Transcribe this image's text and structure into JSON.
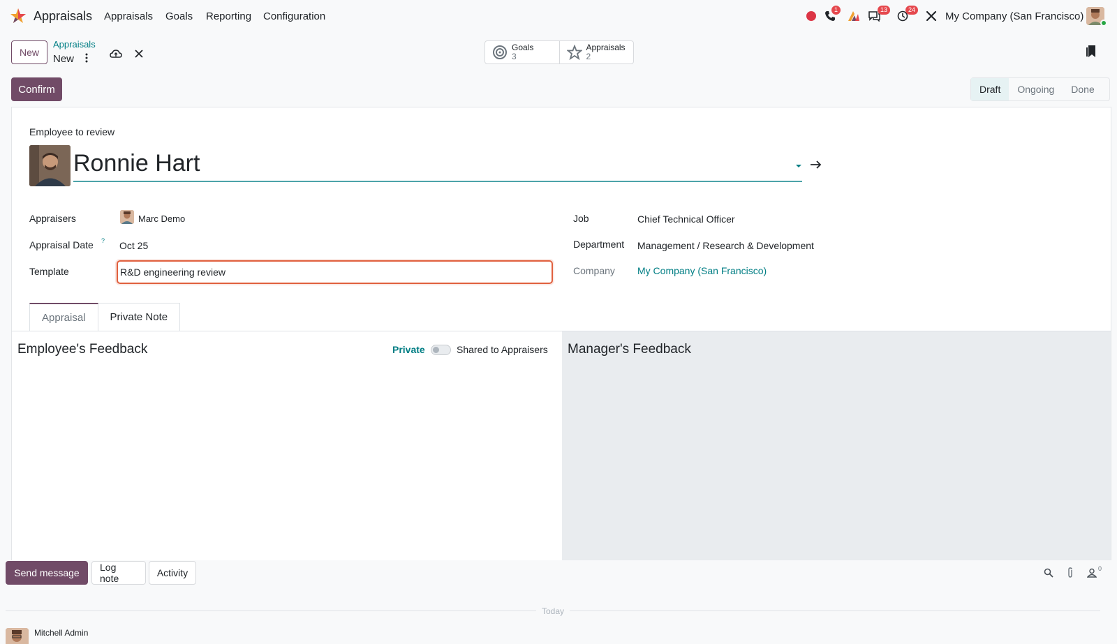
{
  "navbar": {
    "app_name": "Appraisals",
    "menu": [
      "Appraisals",
      "Goals",
      "Reporting",
      "Configuration"
    ],
    "badges": {
      "calls": "1",
      "messages": "13",
      "activities": "24"
    },
    "company": "My Company (San Francisco)",
    "icons": [
      "record-icon",
      "phone-icon",
      "tools-logo-icon",
      "chat-icon",
      "clock-icon",
      "settings-cross-icon"
    ]
  },
  "control_panel": {
    "new_label": "New",
    "breadcrumb_parent": "Appraisals",
    "breadcrumb_current": "New",
    "smart_buttons": [
      {
        "label": "Goals",
        "count": "3",
        "icon": "target-icon"
      },
      {
        "label": "Appraisals",
        "count": "2",
        "icon": "star-icon"
      }
    ]
  },
  "actions": {
    "confirm_label": "Confirm",
    "status": [
      "Draft",
      "Ongoing",
      "Done"
    ],
    "active_status": "Draft"
  },
  "form": {
    "employee_label": "Employee to review",
    "employee_name": "Ronnie Hart",
    "appraisers_label": "Appraisers",
    "appraiser_name": "Marc Demo",
    "date_label": "Appraisal Date",
    "date_help": "?",
    "date_value": "Oct 25",
    "template_label": "Template",
    "template_value": "R&D engineering review",
    "job_label": "Job",
    "job_value": "Chief Technical Officer",
    "department_label": "Department",
    "department_value": "Management / Research & Development",
    "company_label": "Company",
    "company_value": "My Company (San Francisco)"
  },
  "tabs": [
    "Appraisal",
    "Private Note"
  ],
  "feedback": {
    "employee_title": "Employee's Feedback",
    "private_label": "Private",
    "shared_label": "Shared to Appraisers",
    "manager_title": "Manager's Feedback"
  },
  "chatter": {
    "send_label": "Send message",
    "log_label": "Log note",
    "activity_label": "Activity",
    "follower_count": "0",
    "date_separator": "Today",
    "author": "Mitchell Admin"
  },
  "colors": {
    "primary": "#714b67",
    "link": "#017e84",
    "badge": "#e5484d",
    "invalid_border": "#e0603e"
  }
}
